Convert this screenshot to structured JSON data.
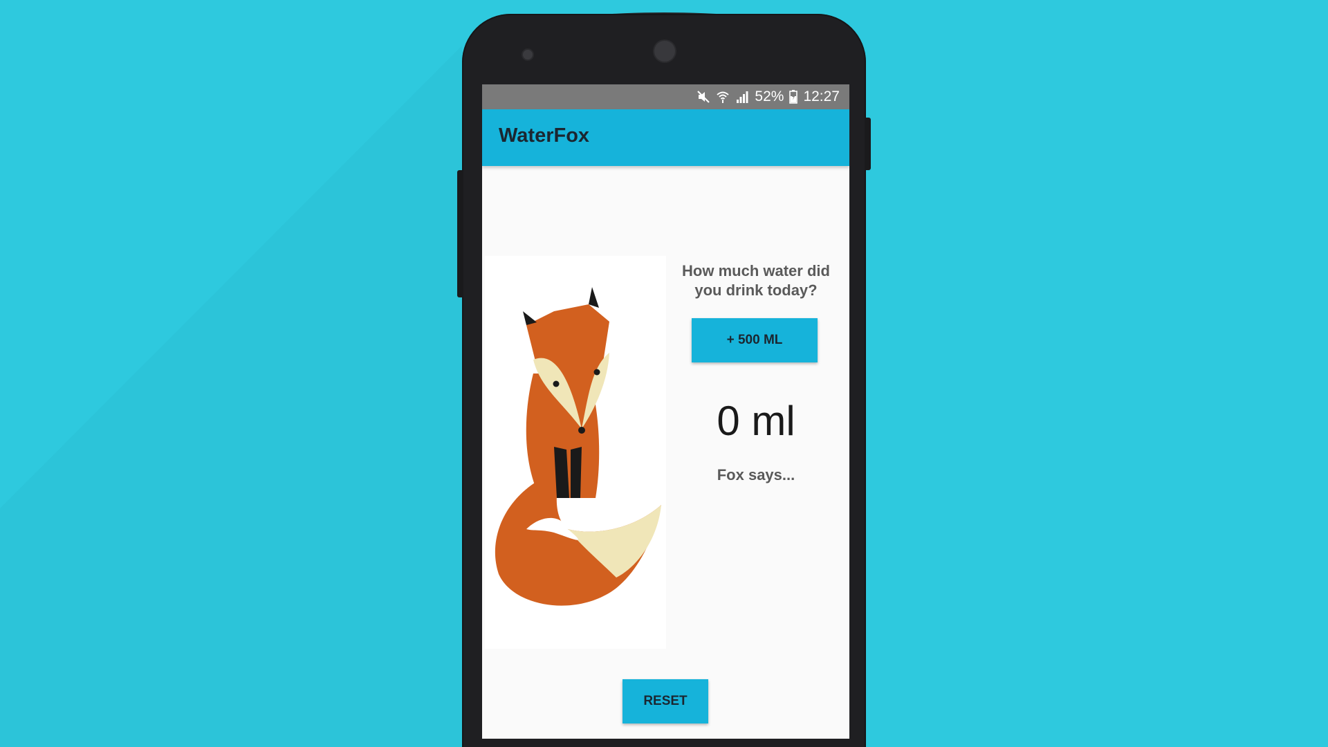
{
  "status_bar": {
    "battery": "52%",
    "time": "12:27",
    "icons": [
      "mute-icon",
      "wifi-icon",
      "signal-icon",
      "battery-icon"
    ]
  },
  "app_bar": {
    "title": "WaterFox"
  },
  "main": {
    "question": "How much water did you drink today?",
    "add_button_label": "+ 500 ML",
    "amount": "0 ml",
    "fox_message": "Fox says...",
    "reset_button_label": "RESET",
    "image": "fox-illustration"
  },
  "colors": {
    "background": "#2ec9de",
    "accent": "#16b3da",
    "status_bar": "#7a7a7a",
    "phone_body": "#1f1f22"
  }
}
